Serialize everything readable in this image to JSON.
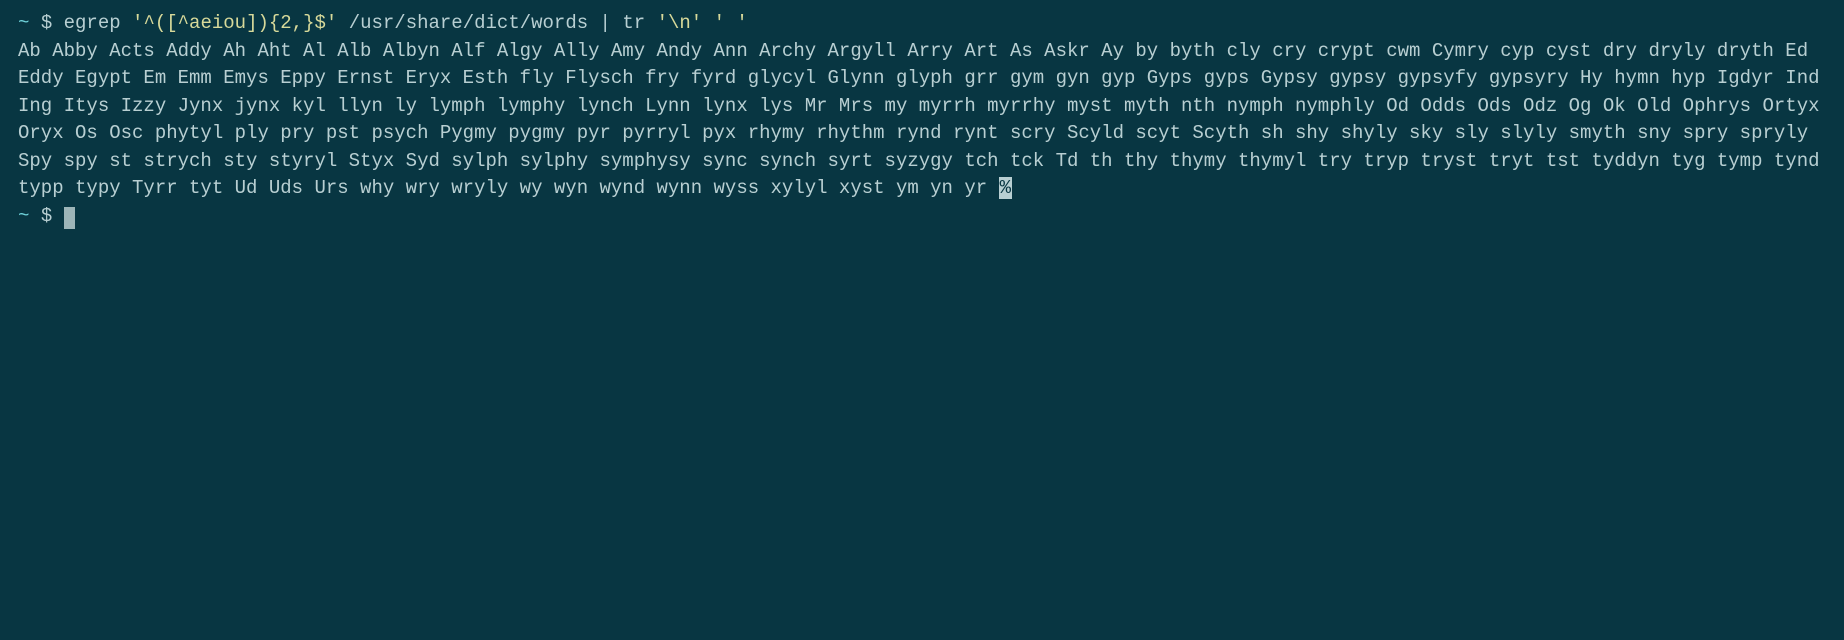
{
  "prompt": {
    "tilde": "~",
    "dollar": "$"
  },
  "command": {
    "egrep": "egrep",
    "regex": "'^([^aeiou]){2,}$'",
    "file": "/usr/share/dict/words",
    "pipe": "|",
    "tr": "tr",
    "arg1": "'\\n'",
    "arg2": "' '"
  },
  "output_words": "Ab Abby Acts Addy Ah Aht Al Alb Albyn Alf Algy Ally Amy Andy Ann Archy Argyll Arry Art As Askr Ay by byth cly cry crypt cwm Cymry cyp cyst dry dryly dryth Ed Eddy Egypt Em Emm Emys Eppy Ernst Eryx Esth fly Flysch fry fyrd glycyl Glynn glyph grr gym gyn gyp Gyps gyps Gypsy gypsy gypsyfy gypsyry Hy hymn hyp Igdyr Ind Ing Itys Izzy Jynx jynx kyl llyn ly lymph lymphy lynch Lynn lynx lys Mr Mrs my myrrh myrrhy myst myth nth nymph nymphly Od Odds Ods Odz Og Ok Old Ophrys Ortyx Oryx Os Osc phytyl ply pry pst psych Pygmy pygmy pyr pyrryl pyx rhymy rhythm rynd rynt scry Scyld scyt Scyth sh shy shyly sky sly slyly smyth sny spry spryly Spy spy st strych sty styryl Styx Syd sylph sylphy symphysy sync synch syrt syzygy tch tck Td th thy thymy thymyl try tryp tryst tryt tst tyddyn tyg tymp tynd typp typy Tyrr tyt Ud Uds Urs why wry wryly wy wyn wynd wynn wyss xylyl xyst ym yn yr ",
  "eol_marker": "%"
}
